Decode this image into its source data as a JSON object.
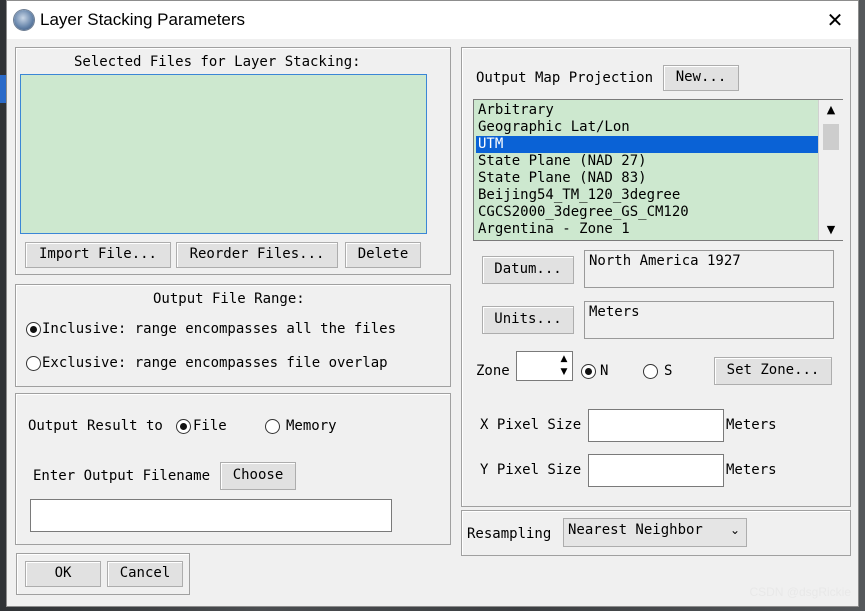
{
  "window": {
    "title": "Layer Stacking Parameters",
    "close_glyph": "✕",
    "icon": "app-globe-icon"
  },
  "selected_files": {
    "label": "Selected Files for Layer Stacking:",
    "import_label": "Import File...",
    "reorder_label": "Reorder Files...",
    "delete_label": "Delete"
  },
  "output_range": {
    "label": "Output File Range:",
    "inclusive": "Inclusive: range encompasses all the files",
    "exclusive": "Exclusive: range encompasses file overlap",
    "selected": "inclusive"
  },
  "output": {
    "result_label": "Output Result to",
    "file_label": "File",
    "memory_label": "Memory",
    "selected": "file",
    "filename_label": "Enter Output Filename",
    "choose_label": "Choose",
    "filename_value": ""
  },
  "dialog_buttons": {
    "ok": "OK",
    "cancel": "Cancel"
  },
  "projection": {
    "label": "Output Map Projection",
    "new_label": "New...",
    "items": [
      "Arbitrary",
      "Geographic Lat/Lon",
      "UTM",
      "State Plane (NAD 27)",
      "State Plane (NAD 83)",
      "Beijing54_TM_120_3degree",
      "CGCS2000_3degree_GS_CM120",
      "Argentina - Zone 1"
    ],
    "selected": "UTM",
    "scroll_up": "▲",
    "scroll_down": "▼",
    "datum_label": "Datum...",
    "datum_value": "North America 1927",
    "units_label": "Units...",
    "units_value": "Meters",
    "zone_label": "Zone",
    "zone_value": "",
    "north_label": "N",
    "south_label": "S",
    "hemisphere": "N",
    "set_zone_label": "Set Zone...",
    "x_pixel_label": "X Pixel Size",
    "x_pixel_value": "",
    "x_pixel_unit": "Meters",
    "y_pixel_label": "Y Pixel Size",
    "y_pixel_value": "",
    "y_pixel_unit": "Meters"
  },
  "resampling": {
    "label": "Resampling",
    "value": "Nearest Neighbor",
    "chevron": "⌄"
  },
  "watermark": "CSDN @dsgRickie"
}
